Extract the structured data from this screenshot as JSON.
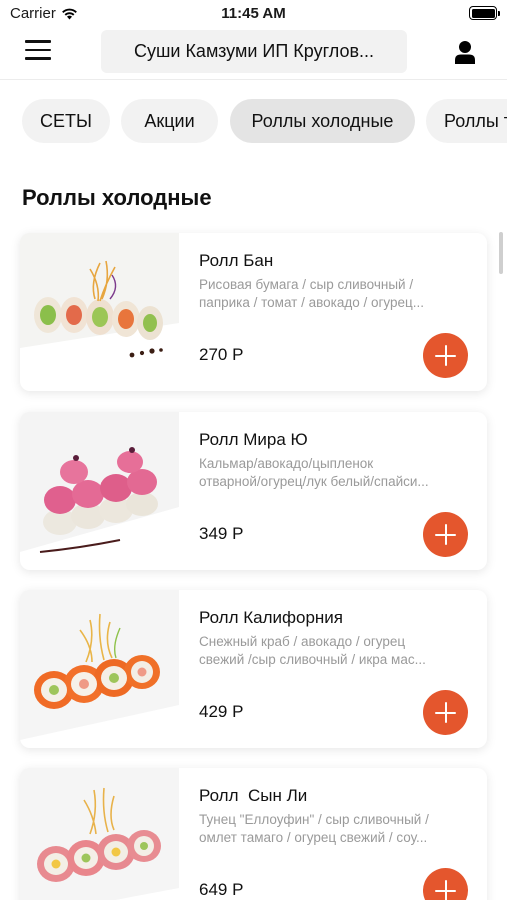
{
  "status_bar": {
    "carrier": "Carrier",
    "time": "11:45 AM",
    "wifi_icon": "wifi-icon",
    "battery_icon": "battery-icon"
  },
  "header": {
    "title": "Суши Камзуми ИП Круглов...",
    "menu_icon": "hamburger-menu-icon",
    "profile_icon": "user-icon"
  },
  "tabs": [
    {
      "label": "СЕТЫ",
      "active": false
    },
    {
      "label": "Акции",
      "active": false
    },
    {
      "label": "Роллы холодные",
      "active": true
    },
    {
      "label": "Роллы т",
      "active": false
    }
  ],
  "section": {
    "title": "Роллы холодные"
  },
  "products": [
    {
      "name": "Ролл Бан",
      "desc_lines": [
        "Рисовая бумага / сыр сливочный /",
        "паприка / томат / авокадо / огурец..."
      ],
      "price": "270 Р",
      "image": "sushi-roll-rice-paper-photo"
    },
    {
      "name": "Ролл Мира Ю",
      "desc_lines": [
        "Кальмар/авокадо/цыпленок",
        "отварной/огурец/лук белый/спайси..."
      ],
      "price": "349 Р",
      "image": "sushi-roll-pink-cream-photo"
    },
    {
      "name": "Ролл Калифорния",
      "desc_lines": [
        "Снежный краб / авокадо / огурец",
        "свежий /сыр сливочный / икра мас..."
      ],
      "price": "429 Р",
      "image": "sushi-roll-california-photo"
    },
    {
      "name": "Ролл  Сын Ли",
      "desc_lines": [
        "Тунец \"Еллоуфин\" / сыр сливочный /",
        "омлет тамаго / огурец свежий / соу..."
      ],
      "price": "649 Р",
      "image": "sushi-roll-tuna-photo"
    }
  ],
  "colors": {
    "accent": "#e4562d",
    "tab_bg": "#f2f2f2",
    "tab_active_bg": "#e4e4e4",
    "desc_text": "#9a9a9a"
  }
}
